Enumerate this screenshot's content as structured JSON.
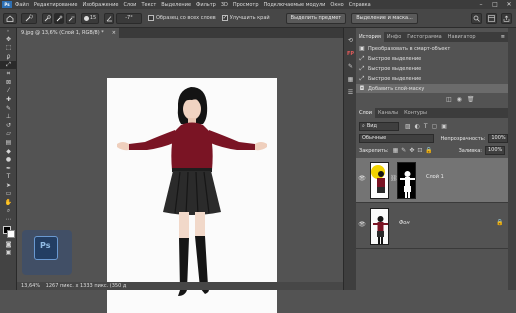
{
  "menubar": {
    "logo": "Ps",
    "items": [
      "Файл",
      "Редактирование",
      "Изображение",
      "Слои",
      "Текст",
      "Выделение",
      "Фильтр",
      "3D",
      "Просмотр",
      "Подключаемые модули",
      "Окно",
      "Справка"
    ],
    "controls": [
      "–",
      "□",
      "✕"
    ]
  },
  "options": {
    "brush_size": "15",
    "angle": "-7°",
    "sample_all_layers": "Образец со всех слоев",
    "sample_all_checked": false,
    "enhance_edge": "Улучшить край",
    "enhance_edge_checked": true,
    "select_subject": "Выделить предмет",
    "select_and_mask": "Выделение и маска..."
  },
  "document": {
    "tab_label": "9.jpg @ 13,6% (Слой 1, RGB/8) *",
    "tab_close": "×"
  },
  "status": {
    "zoom": "13,64%",
    "dimensions": "1267 пикс. х 1333 пикс. (350 д"
  },
  "history": {
    "tabs": [
      "История",
      "Инфо",
      "Гистограмма",
      "Навигатор"
    ],
    "items": [
      {
        "label": "Преобразовать в смарт-объект",
        "icon": "smart-object-icon"
      },
      {
        "label": "Быстрое выделение",
        "icon": "quick-select-icon"
      },
      {
        "label": "Быстрое выделение",
        "icon": "quick-select-icon"
      },
      {
        "label": "Быстрое выделение",
        "icon": "quick-select-icon"
      },
      {
        "label": "Добавить слой-маску",
        "icon": "layer-mask-icon",
        "selected": true
      }
    ]
  },
  "layers": {
    "tabs": [
      "Слои",
      "Каналы",
      "Контуры"
    ],
    "filter_label": "Вид",
    "blend_mode": "Обычные",
    "opacity_label": "Непрозрачность:",
    "opacity_value": "100%",
    "lock_label": "Закрепить:",
    "fill_label": "Заливка:",
    "fill_value": "100%",
    "items": [
      {
        "name": "Слой 1",
        "selected": true,
        "has_mask": true
      },
      {
        "name": "Фон",
        "selected": false,
        "locked": true
      }
    ]
  },
  "colors": {
    "accent": "#2d6fb3",
    "sweater": "#7a1424",
    "skirt": "#2b2b2b",
    "selected_layer": "#747474"
  }
}
